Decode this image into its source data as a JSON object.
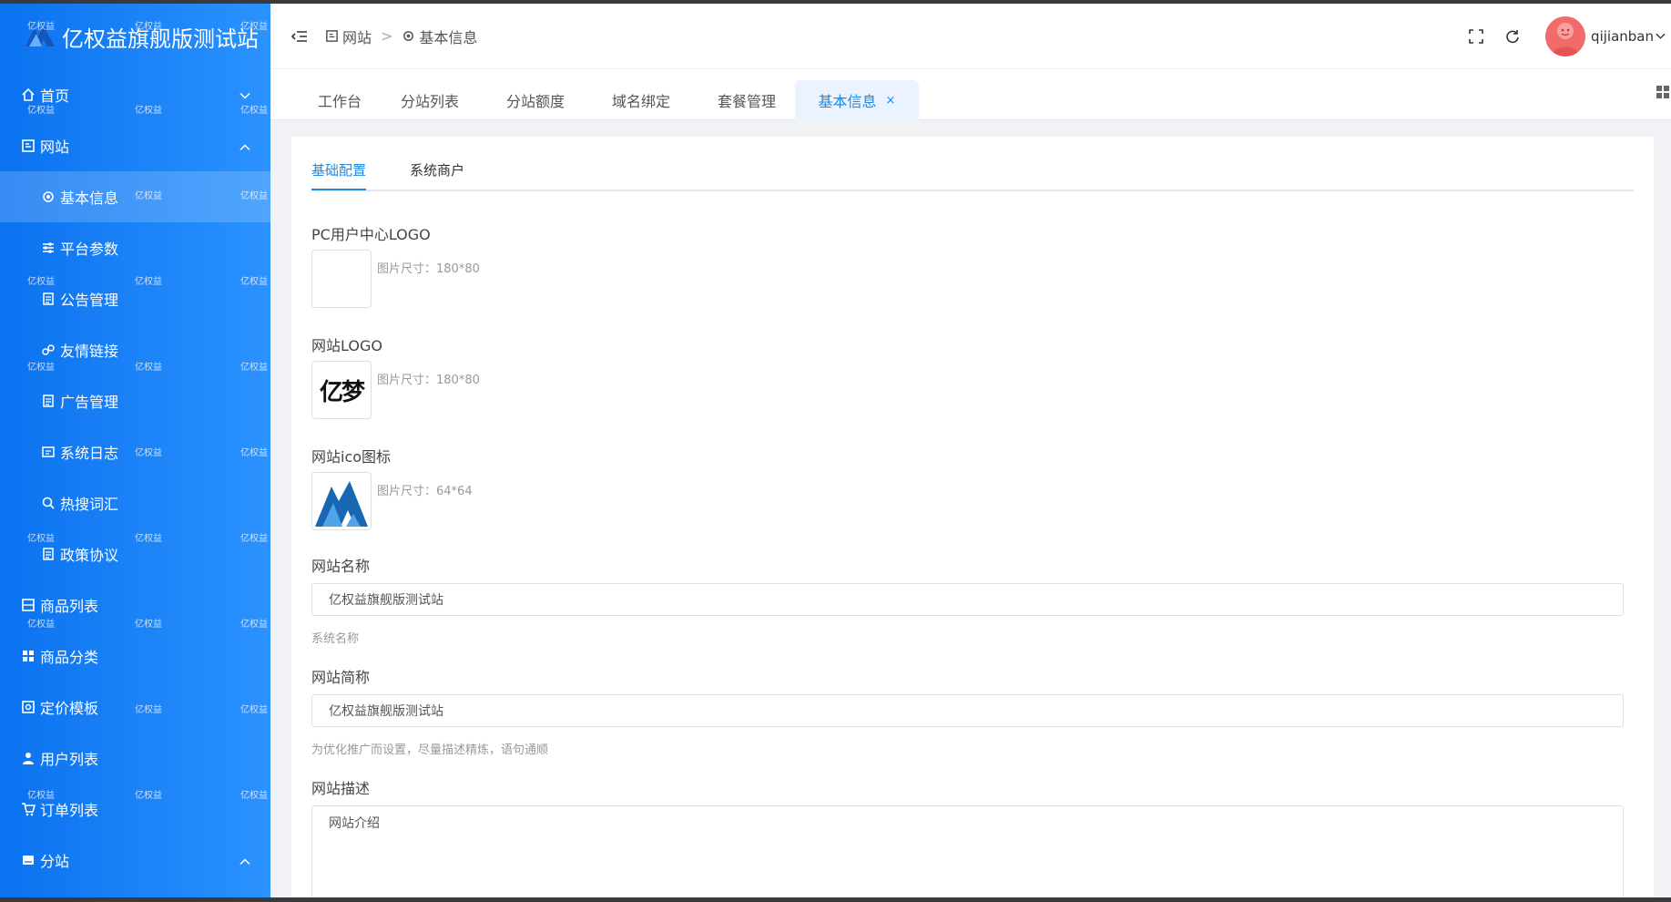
{
  "brand": {
    "title": "亿权益旗舰版测试站"
  },
  "sidebar": {
    "watermark": "亿权益",
    "items": [
      {
        "label": "首页",
        "icon": "home-icon",
        "arrow": "chevron-down"
      },
      {
        "label": "网站",
        "icon": "site-icon",
        "arrow": "chevron-up"
      },
      {
        "label": "基本信息",
        "icon": "gear-icon"
      },
      {
        "label": "平台参数",
        "icon": "sliders-icon"
      },
      {
        "label": "公告管理",
        "icon": "document-icon"
      },
      {
        "label": "友情链接",
        "icon": "link-icon"
      },
      {
        "label": "广告管理",
        "icon": "document-icon"
      },
      {
        "label": "系统日志",
        "icon": "log-icon"
      },
      {
        "label": "热搜词汇",
        "icon": "search-icon"
      },
      {
        "label": "政策协议",
        "icon": "document-icon"
      },
      {
        "label": "商品列表",
        "icon": "box-icon"
      },
      {
        "label": "商品分类",
        "icon": "grid-icon"
      },
      {
        "label": "定价模板",
        "icon": "price-icon"
      },
      {
        "label": "用户列表",
        "icon": "user-icon"
      },
      {
        "label": "订单列表",
        "icon": "cart-icon"
      },
      {
        "label": "分站",
        "icon": "branch-icon",
        "arrow": "chevron-up"
      }
    ]
  },
  "header": {
    "breadcrumb": [
      {
        "label": "网站",
        "icon": "site-icon"
      },
      {
        "label": "基本信息",
        "icon": "gear-icon"
      }
    ],
    "separator": ">",
    "username": "qijianban"
  },
  "tabs": [
    {
      "label": "工作台"
    },
    {
      "label": "分站列表"
    },
    {
      "label": "分站额度"
    },
    {
      "label": "域名绑定"
    },
    {
      "label": "套餐管理"
    },
    {
      "label": "基本信息",
      "active": true,
      "close": "×"
    }
  ],
  "subtabs": [
    {
      "label": "基础配置",
      "active": true
    },
    {
      "label": "系统商户"
    }
  ],
  "form": {
    "pc_logo": {
      "label": "PC用户中心LOGO",
      "hint": "图片尺寸：180*80"
    },
    "site_logo": {
      "label": "网站LOGO",
      "hint": "图片尺寸：180*80",
      "image_text": "亿梦"
    },
    "site_icon": {
      "label": "网站ico图标",
      "hint": "图片尺寸：64*64"
    },
    "site_name": {
      "label": "网站名称",
      "value": "亿权益旗舰版测试站",
      "help": "系统名称"
    },
    "site_short": {
      "label": "网站简称",
      "value": "亿权益旗舰版测试站",
      "help": "为优化推广而设置，尽量描述精炼，语句通顺"
    },
    "site_desc": {
      "label": "网站描述",
      "value": "网站介绍"
    }
  },
  "colors": {
    "sidebar": "#0b72f0",
    "accent": "#1e88e5",
    "avatar": "#f26b6b"
  }
}
